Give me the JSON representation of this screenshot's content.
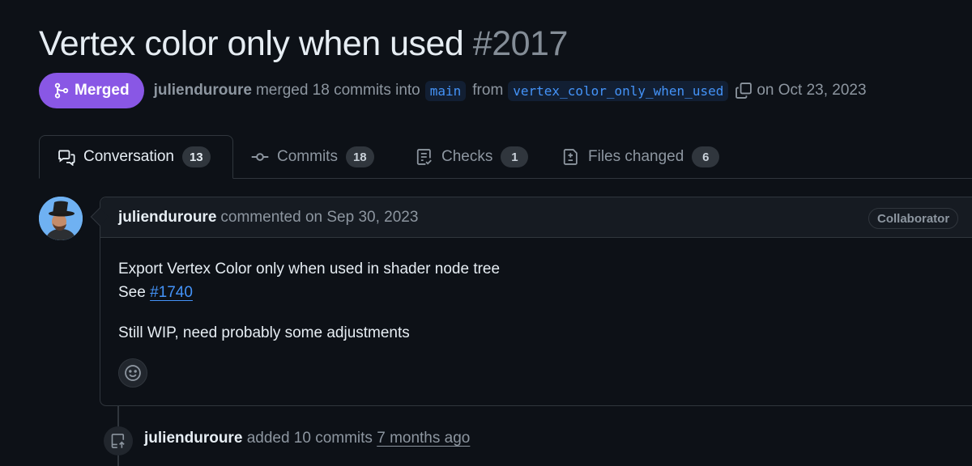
{
  "pr": {
    "title": "Vertex color only when used",
    "number": "#2017",
    "status_badge": {
      "label": "Merged",
      "icon": "git-merge-icon",
      "color": "#8957e5"
    },
    "meta": {
      "author": "julienduroure",
      "action_text": "merged 18 commits into",
      "base_branch": "main",
      "from_text": "from",
      "head_branch": "vertex_color_only_when_used",
      "copy_icon": "copy-icon",
      "date_text": "on Oct 23, 2023"
    }
  },
  "tabs": [
    {
      "label": "Conversation",
      "count": "13",
      "icon": "comment-discussion-icon",
      "active": true
    },
    {
      "label": "Commits",
      "count": "18",
      "icon": "git-commit-icon",
      "active": false
    },
    {
      "label": "Checks",
      "count": "1",
      "icon": "checklist-icon",
      "active": false
    },
    {
      "label": "Files changed",
      "count": "6",
      "icon": "file-diff-icon",
      "active": false
    }
  ],
  "comment": {
    "author": "julienduroure",
    "meta": "commented on Sep 30, 2023",
    "role": "Collaborator",
    "body": {
      "line1": "Export Vertex Color only when used in shader node tree",
      "see_prefix": "See",
      "link": "#1740",
      "line3": "Still WIP, need probably some adjustments"
    },
    "reaction_icon": "smiley-icon"
  },
  "timeline_event": {
    "icon": "repo-push-icon",
    "author": "julienduroure",
    "action": "added 10 commits",
    "time": "7 months ago"
  },
  "colors": {
    "background": "#0d1117",
    "merged": "#8957e5",
    "link": "#4493f8",
    "border": "#30363d",
    "muted_text": "#8d96a0"
  }
}
